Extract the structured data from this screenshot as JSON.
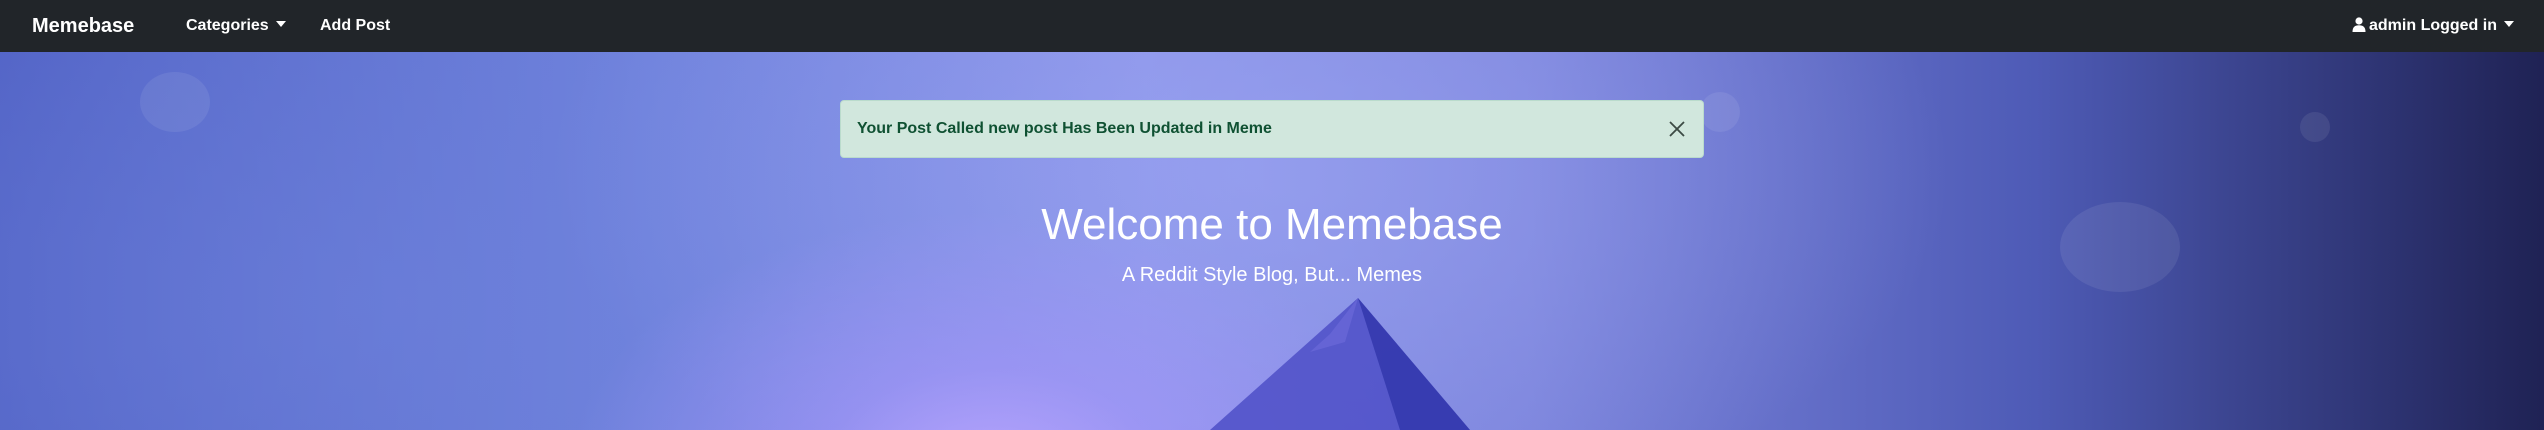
{
  "navbar": {
    "brand": "Memebase",
    "categories_label": "Categories",
    "add_post_label": "Add Post",
    "user_label": "admin Logged in"
  },
  "alert": {
    "message": "Your Post Called new post Has Been Updated in Meme"
  },
  "hero": {
    "title": "Welcome to Memebase",
    "subtitle": "A Reddit Style Blog, But... Memes"
  },
  "icons": {
    "user": "user-icon",
    "close": "close-icon",
    "caret": "caret-down-icon"
  },
  "colors": {
    "navbar_bg": "#212529",
    "alert_bg": "#d1e7dd",
    "alert_text": "#0f5132",
    "hero_text": "#ffffff"
  }
}
